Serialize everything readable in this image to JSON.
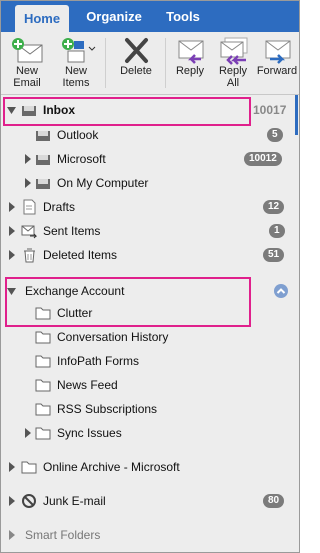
{
  "tabs": [
    "Home",
    "Organize",
    "Tools"
  ],
  "ribbon": {
    "new_email": "New\nEmail",
    "new_items": "New\nItems",
    "delete": "Delete",
    "reply": "Reply",
    "reply_all": "Reply\nAll",
    "forward": "Forward"
  },
  "folders": {
    "inbox": "Inbox",
    "inbox_count": "10017",
    "outlook": "Outlook",
    "outlook_count": "5",
    "microsoft": "Microsoft",
    "microsoft_count": "10012",
    "on_my_computer": "On My Computer",
    "drafts": "Drafts",
    "drafts_count": "12",
    "sent": "Sent Items",
    "sent_count": "1",
    "deleted": "Deleted Items",
    "deleted_count": "51",
    "exchange": "Exchange Account",
    "clutter": "Clutter",
    "conversation_history": "Conversation History",
    "infopath": "InfoPath Forms",
    "news_feed": "News Feed",
    "rss": "RSS Subscriptions",
    "sync_issues": "Sync Issues",
    "online_archive": "Online Archive - Microsoft",
    "junk": "Junk E-mail",
    "junk_count": "80",
    "smart_folders": "Smart Folders"
  },
  "colors": {
    "accent": "#2d6cc0",
    "highlight": "#e0208c",
    "badge": "#7b7b7b"
  }
}
